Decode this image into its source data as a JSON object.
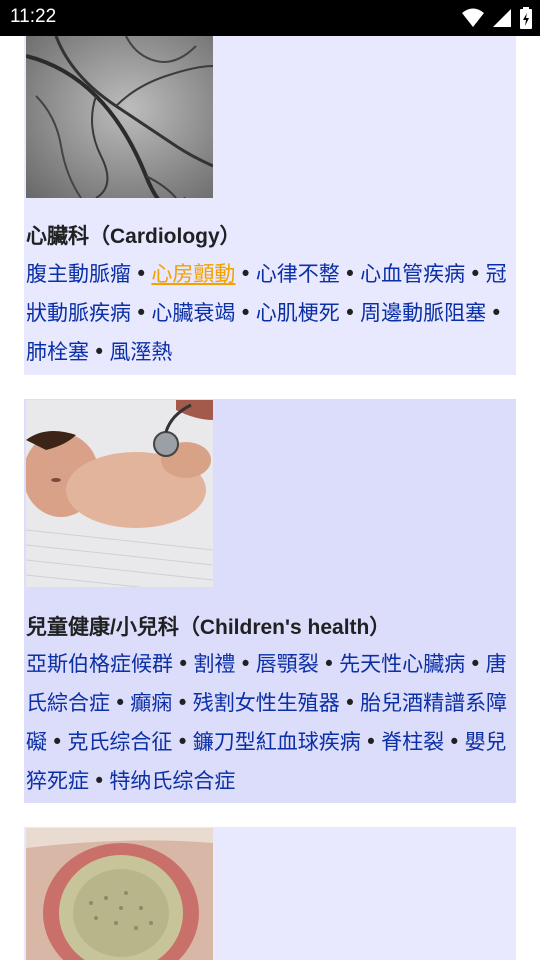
{
  "status_bar": {
    "time": "11:22",
    "icons": [
      "wifi-icon",
      "signal-icon",
      "battery-icon"
    ]
  },
  "sections": [
    {
      "title": "心臟科（Cardiology）",
      "image": "coronary-angiogram-image",
      "links": [
        {
          "label": "腹主動脈瘤",
          "highlighted": false
        },
        {
          "label": "心房顫動",
          "highlighted": true
        },
        {
          "label": "心律不整",
          "highlighted": false
        },
        {
          "label": "心血管疾病",
          "highlighted": false
        },
        {
          "label": "冠狀動脈疾病",
          "highlighted": false
        },
        {
          "label": "心臟衰竭",
          "highlighted": false
        },
        {
          "label": "心肌梗死",
          "highlighted": false
        },
        {
          "label": "周邊動脈阻塞",
          "highlighted": false
        },
        {
          "label": "肺栓塞",
          "highlighted": false
        },
        {
          "label": "風溼熱",
          "highlighted": false
        }
      ]
    },
    {
      "title": "兒童健康/小兒科（Children's health）",
      "image": "infant-stethoscope-image",
      "links": [
        {
          "label": "亞斯伯格症候群",
          "highlighted": false
        },
        {
          "label": "割禮",
          "highlighted": false
        },
        {
          "label": "唇顎裂",
          "highlighted": false
        },
        {
          "label": "先天性心臟病",
          "highlighted": false
        },
        {
          "label": "唐氏綜合症",
          "highlighted": false
        },
        {
          "label": "癲痫",
          "highlighted": false
        },
        {
          "label": "残割女性生殖器",
          "highlighted": false
        },
        {
          "label": "胎兒酒精譜系障礙",
          "highlighted": false
        },
        {
          "label": "克氏综合征",
          "highlighted": false
        },
        {
          "label": "鐮刀型紅血球疾病",
          "highlighted": false
        },
        {
          "label": "脊柱裂",
          "highlighted": false
        },
        {
          "label": "嬰兒猝死症",
          "highlighted": false
        },
        {
          "label": "特纳氏综合症",
          "highlighted": false
        }
      ]
    },
    {
      "title": "",
      "image": "skin-condition-image",
      "links": []
    }
  ],
  "colors": {
    "link": "#0b2fa5",
    "visited_link": "#f2a100",
    "card_bg": "#e8e8ff",
    "card_bg_alt": "#dcdcfb"
  }
}
